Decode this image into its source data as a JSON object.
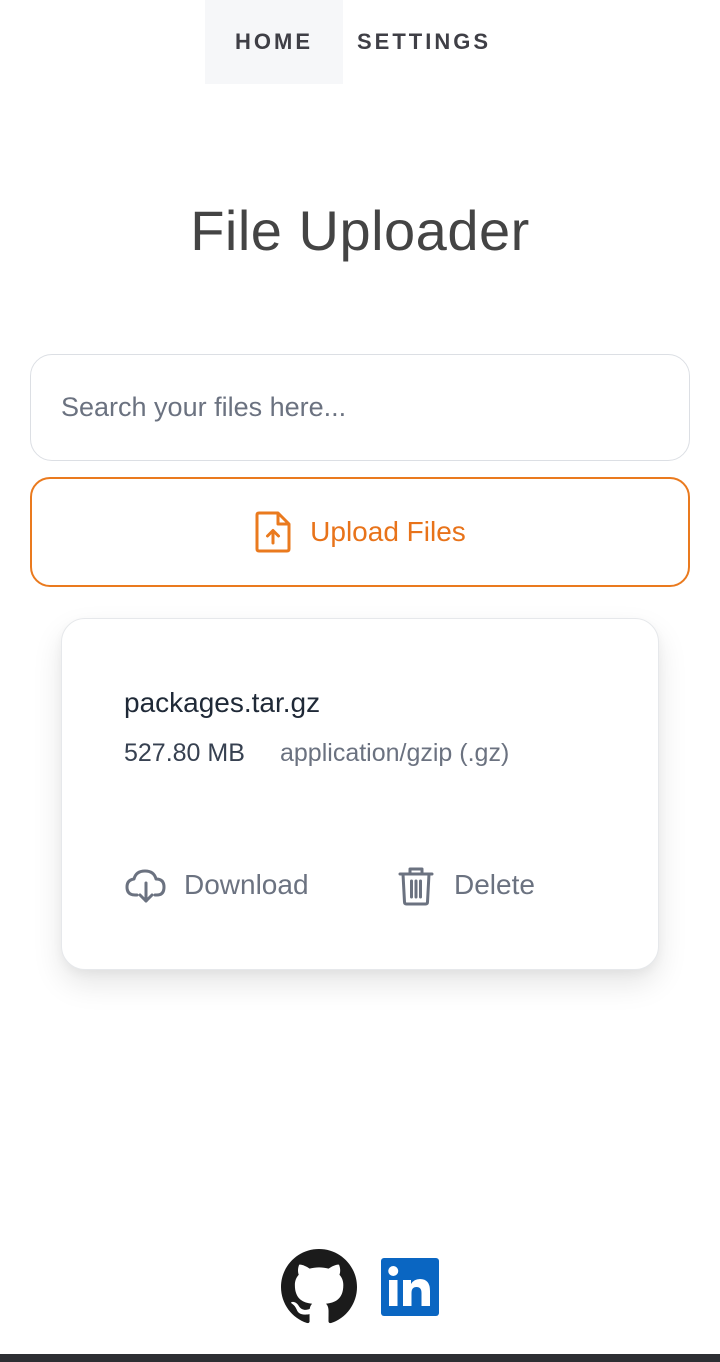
{
  "nav": {
    "tabs": [
      {
        "label": "HOME",
        "active": true
      },
      {
        "label": "SETTINGS",
        "active": false
      }
    ]
  },
  "page": {
    "title": "File Uploader"
  },
  "search": {
    "placeholder": "Search your files here...",
    "value": ""
  },
  "upload": {
    "label": "Upload Files",
    "icon": "file-upload-icon"
  },
  "file_card": {
    "name": "packages.tar.gz",
    "size": "527.80 MB",
    "type": "application/gzip (.gz)",
    "download_label": "Download",
    "delete_label": "Delete"
  },
  "footer": {
    "links": [
      {
        "icon": "github-icon"
      },
      {
        "icon": "linkedin-icon"
      }
    ]
  },
  "colors": {
    "accent": "#ea7a1e",
    "linkedin": "#0a66c2",
    "github": "#1b1b1b"
  }
}
